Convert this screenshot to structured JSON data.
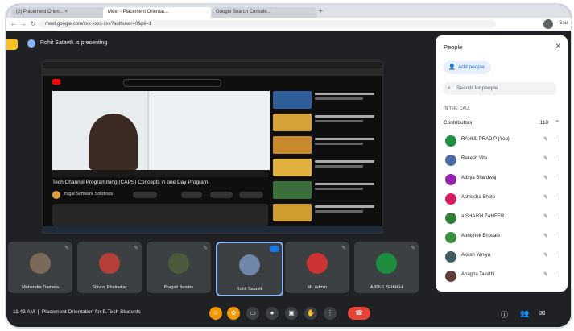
{
  "browser": {
    "tabs": [
      "(2) Placement Orien... ×",
      "Meet - Placement Orientat...",
      "Google Search Console..."
    ],
    "url": "meet.google.com/xxx-xxxx-xxx?authuser=0&pli=1",
    "profile_label": "Seu"
  },
  "meet": {
    "presenting_banner": "Rohit Satavtk is presenting",
    "shared_video_title": "Tech Channel Programming (CAPS) Concepts in one Day Program",
    "channel_name": "Yugal Software Solutions",
    "participants_tiles": [
      {
        "name": "Mahendra Damera",
        "color": "#7a6a5a"
      },
      {
        "name": "Shivraj Phalnekar",
        "color": "#b5403a"
      },
      {
        "name": "Pragati Bendre",
        "color": "#4a5a3a"
      },
      {
        "name": "Rohit Satavtk",
        "color": "#6f86a8"
      },
      {
        "name": "Mr. Admin",
        "color": "#cc3333"
      },
      {
        "name": "ABDUL SHAIKH",
        "color": "#1e8e3e"
      }
    ],
    "bottom_bar": {
      "time": "11:43 AM",
      "meeting_title": "Placement Orientation for B.Tech Students"
    }
  },
  "people_panel": {
    "title": "People",
    "add_people": "Add people",
    "search_placeholder": "Search for people",
    "in_call_label": "IN THE CALL",
    "contributors_label": "Contributors",
    "contributors_count": "118",
    "people": [
      {
        "name": "RAHUL PRADIP (You)",
        "color": "#1e8e3e"
      },
      {
        "name": "Rakesh Vite",
        "color": "#4a6da7"
      },
      {
        "name": "Aditya Bhardwaj",
        "color": "#8e24aa"
      },
      {
        "name": "Ashlesha Shete",
        "color": "#d81b60"
      },
      {
        "name": "a.SHAIKH ZAHEER",
        "color": "#2e7d32"
      },
      {
        "name": "Abhishek Bhosale",
        "color": "#388e3c"
      },
      {
        "name": "Akash Yaniya",
        "color": "#455a64"
      },
      {
        "name": "Anagha Tavathi",
        "color": "#5d4037"
      }
    ]
  }
}
